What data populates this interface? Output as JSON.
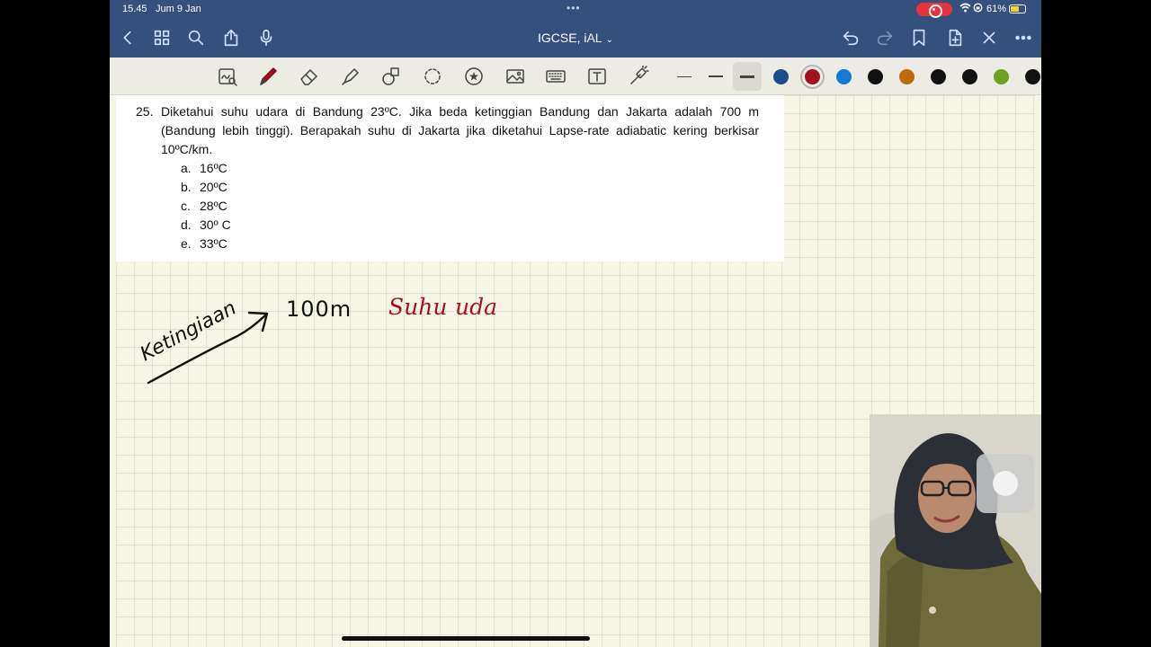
{
  "status": {
    "time": "15.45",
    "date": "Jum 9 Jan",
    "battery": "61%",
    "battery_level": 0.61
  },
  "nav": {
    "title": "IGCSE, iAL",
    "title_chevron": "⌄",
    "icons": [
      "back-icon",
      "thumbnails-icon",
      "search-icon",
      "share-icon",
      "microphone-icon",
      "undo-icon",
      "redo-icon",
      "bookmark-icon",
      "add-page-icon",
      "close-icon",
      "more-icon"
    ]
  },
  "toolbar": {
    "tools": [
      "zoom-window-icon",
      "pen-icon",
      "eraser-icon",
      "highlighter-icon",
      "shapes-icon",
      "lasso-icon",
      "elements-icon",
      "image-icon",
      "keyboard-icon",
      "text-icon",
      "laser-pointer-icon"
    ],
    "colors": [
      "#1d4e8a",
      "#a4111c",
      "#1479d9",
      "#111111",
      "#c06a0f",
      "#111111",
      "#111111",
      "#6ba31e",
      "#111111"
    ],
    "selected_color": "#a4111c"
  },
  "question": {
    "number": "25.",
    "text": "Diketahui suhu udara di Bandung 23ºC. Jika beda ketinggian Bandung dan Jakarta adalah 700 m (Bandung lebih tinggi). Berapakah suhu di Jakarta jika diketahui Lapse-rate adiabatic kering berkisar 10ºC/km.",
    "options": [
      {
        "letter": "a.",
        "text": "16ºC"
      },
      {
        "letter": "b.",
        "text": "20ºC"
      },
      {
        "letter": "c.",
        "text": "28ºC"
      },
      {
        "letter": "d.",
        "text": "30º C"
      },
      {
        "letter": "e.",
        "text": "33ºC"
      }
    ]
  },
  "handwriting": {
    "ketinggian": "Ketingiaan",
    "height": "100m",
    "suhu": "Suhu",
    "udara": "uda"
  }
}
